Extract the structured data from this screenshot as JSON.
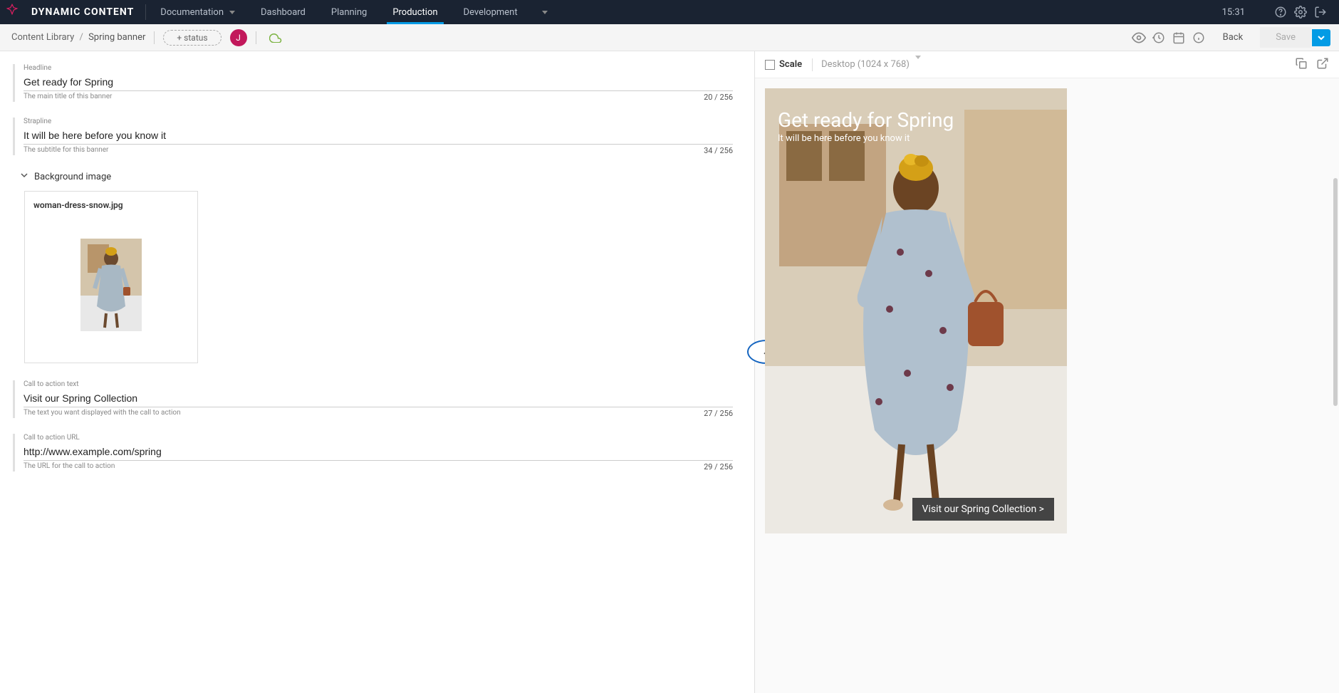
{
  "brand": "DYNAMIC CONTENT",
  "nav": {
    "docs": "Documentation",
    "items": [
      "Dashboard",
      "Planning",
      "Production",
      "Development"
    ],
    "active_index": 2,
    "time": "15:31"
  },
  "breadcrumb": {
    "root": "Content Library",
    "current": "Spring banner"
  },
  "status_button": "+ status",
  "avatar_initial": "J",
  "buttons": {
    "back": "Back",
    "save": "Save"
  },
  "form": {
    "headline": {
      "label": "Headline",
      "value": "Get ready for Spring",
      "help": "The main title of this banner",
      "count": "20 / 256"
    },
    "strapline": {
      "label": "Strapline",
      "value": "It will be here before you know it",
      "help": "The subtitle for this banner",
      "count": "34 / 256"
    },
    "bg_section": "Background image",
    "bg_filename": "woman-dress-snow.jpg",
    "cta_text": {
      "label": "Call to action text",
      "value": "Visit our Spring Collection",
      "help": "The text you want displayed with the call to action",
      "count": "27 / 256"
    },
    "cta_url": {
      "label": "Call to action URL",
      "value": "http://www.example.com/spring",
      "help": "The URL for the call to action",
      "count": "29 / 256"
    }
  },
  "preview": {
    "scale_label": "Scale",
    "device": "Desktop (1024 x 768)",
    "banner_headline": "Get ready for Spring",
    "banner_strapline": "It will be here before you know it",
    "banner_cta": "Visit our Spring Collection >"
  }
}
